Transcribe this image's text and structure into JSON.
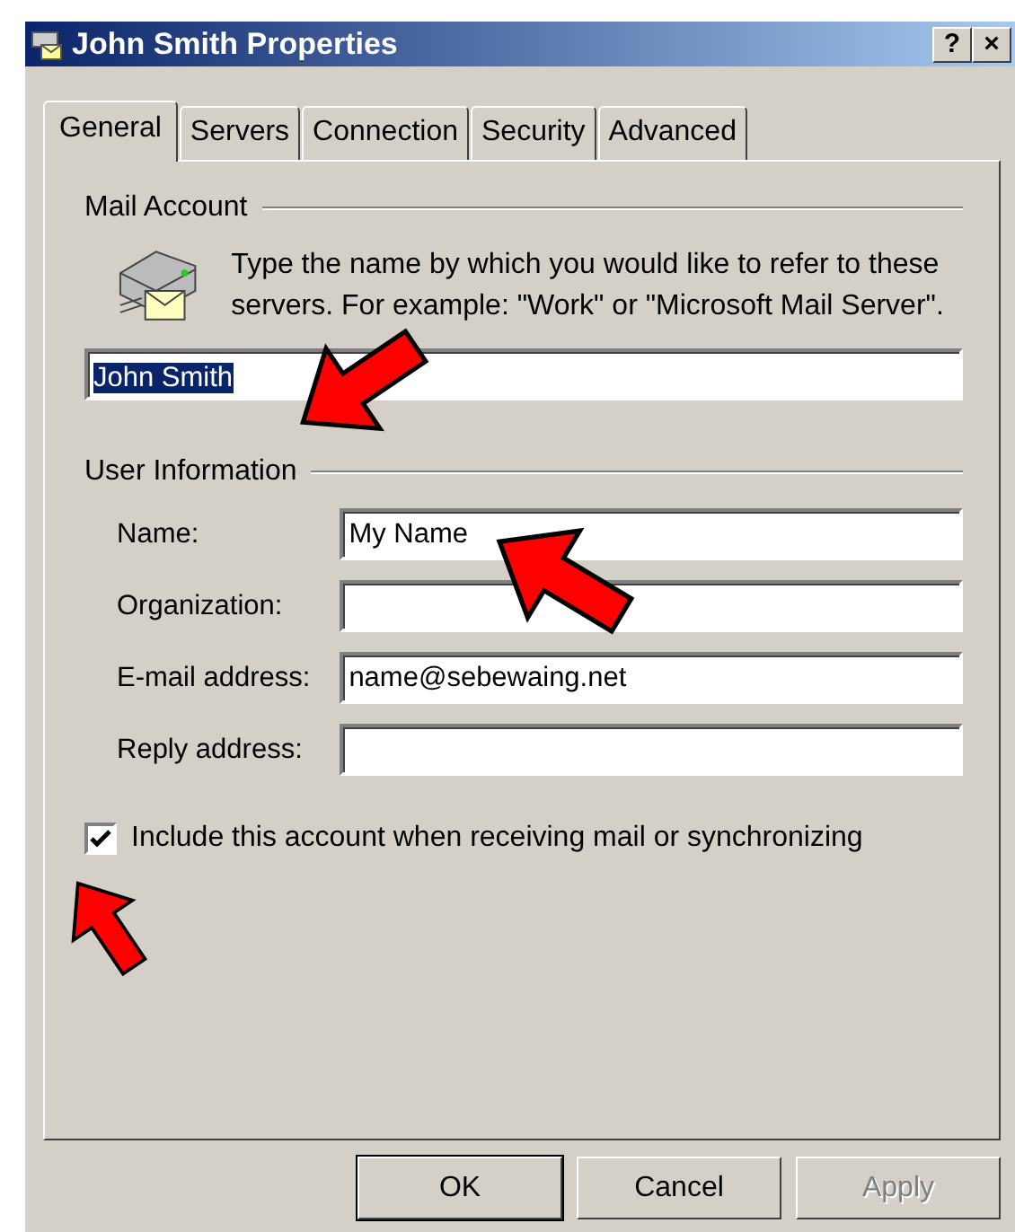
{
  "window": {
    "title": "John Smith Properties",
    "controls": [
      "?",
      "×"
    ]
  },
  "tabs": [
    {
      "label": "General",
      "selected": true
    },
    {
      "label": "Servers",
      "selected": false
    },
    {
      "label": "Connection",
      "selected": false
    },
    {
      "label": "Security",
      "selected": false
    },
    {
      "label": "Advanced",
      "selected": false
    }
  ],
  "mail_account": {
    "heading": "Mail Account",
    "description": "Type the name by which you would like to refer to these servers.  For example: \"Work\" or \"Microsoft Mail Server\".",
    "account_name": {
      "value": "John Smith",
      "selected": true
    }
  },
  "user_information": {
    "heading": "User Information",
    "fields": [
      {
        "label": "Name:",
        "value": "My Name"
      },
      {
        "label": "Organization:"
      },
      {
        "label": "E-mail address:",
        "value": "name@sebewaing.net"
      },
      {
        "label": "Reply address:"
      }
    ]
  },
  "include_account": {
    "label": "Include this account when receiving mail or synchronizing",
    "checked": true
  },
  "buttons": [
    {
      "label": "OK",
      "default": true,
      "disabled": false
    },
    {
      "label": "Cancel",
      "default": false,
      "disabled": false
    },
    {
      "label": "Apply",
      "default": false,
      "disabled": true
    }
  ]
}
